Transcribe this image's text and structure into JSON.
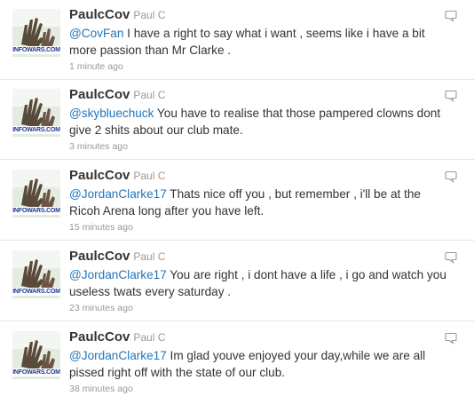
{
  "tweets": [
    {
      "screen_name": "PaulcCov",
      "full_name": "Paul C",
      "avatar_caption": "INFOWARS.COM",
      "mention": "@CovFan",
      "text": " I have a right to say what i want , seems like i have a bit more passion than Mr Clarke .",
      "time": "1 minute ago"
    },
    {
      "screen_name": "PaulcCov",
      "full_name": "Paul C",
      "avatar_caption": "INFOWARS.COM",
      "mention": "@skybluechuck",
      "text": " You have to realise that those pampered clowns dont give 2 shits about our club mate.",
      "time": "3 minutes ago"
    },
    {
      "screen_name": "PaulcCov",
      "full_name": "Paul C",
      "avatar_caption": "INFOWARS.COM",
      "mention": "@JordanClarke17",
      "text": " Thats nice off you , but remember , i'll be at the Ricoh Arena long after you have left.",
      "time": "15 minutes ago"
    },
    {
      "screen_name": "PaulcCov",
      "full_name": "Paul C",
      "avatar_caption": "INFOWARS.COM",
      "mention": "@JordanClarke17",
      "text": " You are right , i dont have a life , i go and watch you useless twats every saturday .",
      "time": "23 minutes ago"
    },
    {
      "screen_name": "PaulcCov",
      "full_name": "Paul C",
      "avatar_caption": "INFOWARS.COM",
      "mention": "@JordanClarke17",
      "text": " Im glad youve enjoyed your day,while we are all pissed right off with the state of our club.",
      "time": "38 minutes ago"
    }
  ],
  "colors": {
    "link": "#2276bb",
    "muted": "#999999",
    "text": "#333333"
  },
  "icons": {
    "reply": "speech-bubble-icon"
  }
}
